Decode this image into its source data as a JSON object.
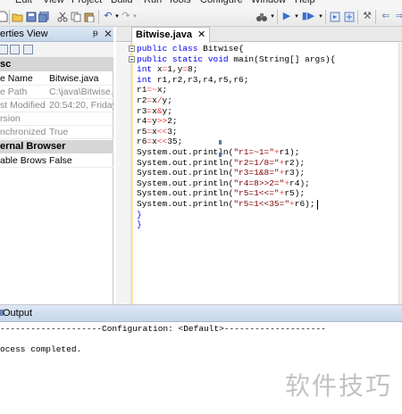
{
  "menu": [
    {
      "label": "Edit"
    },
    {
      "label": "View"
    },
    {
      "label": "Project"
    },
    {
      "label": "Build"
    },
    {
      "label": "Run"
    },
    {
      "label": "Tools"
    },
    {
      "label": "Configure"
    },
    {
      "label": "Window"
    },
    {
      "label": "Help"
    }
  ],
  "toolbar_icons": [
    "new-file-icon",
    "open-folder-icon",
    "save-icon",
    "save-all-icon",
    "cut-icon",
    "copy-icon",
    "paste-icon",
    "undo-icon",
    "redo-icon",
    "binoculars-icon",
    "run-icon",
    "debug-icon",
    "step-icon",
    "zoom-icon",
    "gear-icon",
    "arrow-icon",
    "arrow-left-icon"
  ],
  "properties_panel": {
    "title": "erties View",
    "pin": "ᵽ",
    "close": "✕",
    "categories": [
      {
        "label": "sc"
      },
      {
        "label": "ernal Browser"
      }
    ],
    "rows": [
      {
        "key": "e Name",
        "value": "Bitwise.java",
        "grey": false
      },
      {
        "key": "e Path",
        "value": "C:\\java\\Bitwise.jav",
        "grey": true
      },
      {
        "key": "st Modified",
        "value": "20:54:20, Friday,",
        "grey": true
      },
      {
        "key": "rsion",
        "value": "",
        "grey": true
      },
      {
        "key": "nchronized",
        "value": "True",
        "grey": true
      },
      {
        "key": "able Browse",
        "value": "False",
        "grey": false
      }
    ]
  },
  "editor": {
    "tab_label": "Bitwise.java",
    "tab_close": "✕",
    "lines": [
      [
        {
          "t": "public class ",
          "c": "kw"
        },
        {
          "t": "Bitwise{",
          "c": ""
        }
      ],
      [
        {
          "t": "public static void ",
          "c": "kw"
        },
        {
          "t": "main(String[] args){",
          "c": ""
        }
      ],
      [
        {
          "t": "int ",
          "c": "kw"
        },
        {
          "t": "x",
          "c": ""
        },
        {
          "t": "=",
          "c": "op"
        },
        {
          "t": "1,y",
          "c": ""
        },
        {
          "t": "=",
          "c": "op"
        },
        {
          "t": "8;",
          "c": ""
        }
      ],
      [
        {
          "t": "int ",
          "c": "kw"
        },
        {
          "t": "r1,r2,r3,r4,r5,r6;",
          "c": ""
        }
      ],
      [
        {
          "t": "r1",
          "c": ""
        },
        {
          "t": "=~",
          "c": "op"
        },
        {
          "t": "x;",
          "c": ""
        }
      ],
      [
        {
          "t": "r2",
          "c": ""
        },
        {
          "t": "=",
          "c": "op"
        },
        {
          "t": "x",
          "c": ""
        },
        {
          "t": "/",
          "c": "op"
        },
        {
          "t": "y;",
          "c": ""
        }
      ],
      [
        {
          "t": "r3",
          "c": ""
        },
        {
          "t": "=",
          "c": "op"
        },
        {
          "t": "x",
          "c": ""
        },
        {
          "t": "&",
          "c": "op"
        },
        {
          "t": "y;",
          "c": ""
        }
      ],
      [
        {
          "t": "r4",
          "c": ""
        },
        {
          "t": "=",
          "c": "op"
        },
        {
          "t": "y",
          "c": ""
        },
        {
          "t": ">>",
          "c": "op"
        },
        {
          "t": "2;",
          "c": ""
        }
      ],
      [
        {
          "t": "r5",
          "c": ""
        },
        {
          "t": "=",
          "c": "op"
        },
        {
          "t": "x",
          "c": ""
        },
        {
          "t": "<<",
          "c": "op"
        },
        {
          "t": "3;",
          "c": ""
        }
      ],
      [
        {
          "t": "r6",
          "c": ""
        },
        {
          "t": "=",
          "c": "op"
        },
        {
          "t": "x",
          "c": ""
        },
        {
          "t": "<<",
          "c": "op"
        },
        {
          "t": "35;",
          "c": ""
        }
      ],
      [
        {
          "t": "System.out.println(",
          "c": ""
        },
        {
          "t": "\"r1=~1=\"",
          "c": "str"
        },
        {
          "t": "+",
          "c": "op"
        },
        {
          "t": "r1);",
          "c": ""
        }
      ],
      [
        {
          "t": "System.out.println(",
          "c": ""
        },
        {
          "t": "\"r2=1/8=\"",
          "c": "str"
        },
        {
          "t": "+",
          "c": "op"
        },
        {
          "t": "r2);",
          "c": ""
        }
      ],
      [
        {
          "t": "System.out.println(",
          "c": ""
        },
        {
          "t": "\"r3=1&8=\"",
          "c": "str"
        },
        {
          "t": "+",
          "c": "op"
        },
        {
          "t": "r3);",
          "c": ""
        }
      ],
      [
        {
          "t": "System.out.println(",
          "c": ""
        },
        {
          "t": "\"r4=8>>2=\"",
          "c": "str"
        },
        {
          "t": "+",
          "c": "op"
        },
        {
          "t": "r4);",
          "c": ""
        }
      ],
      [
        {
          "t": "System.out.println(",
          "c": ""
        },
        {
          "t": "\"r5=1<<=\"",
          "c": "str"
        },
        {
          "t": "+",
          "c": "op"
        },
        {
          "t": "r5);",
          "c": ""
        }
      ],
      [
        {
          "t": "System.out.println(",
          "c": ""
        },
        {
          "t": "\"r5=1<<35=\"",
          "c": "str"
        },
        {
          "t": "+",
          "c": "op"
        },
        {
          "t": "r6);",
          "c": ""
        }
      ],
      [
        {
          "t": "}",
          "c": "brk"
        }
      ],
      [
        {
          "t": "}",
          "c": "brk"
        }
      ]
    ]
  },
  "output": {
    "title": "Output",
    "lines": [
      "--------------------Configuration: <Default>--------------------",
      "",
      "ocess completed."
    ]
  },
  "watermark": "软件技巧",
  "colors": {
    "keyword": "#0000ee",
    "string": "#800000",
    "operator": "#ff3a3a",
    "panel_title": "#c7d6ea"
  }
}
